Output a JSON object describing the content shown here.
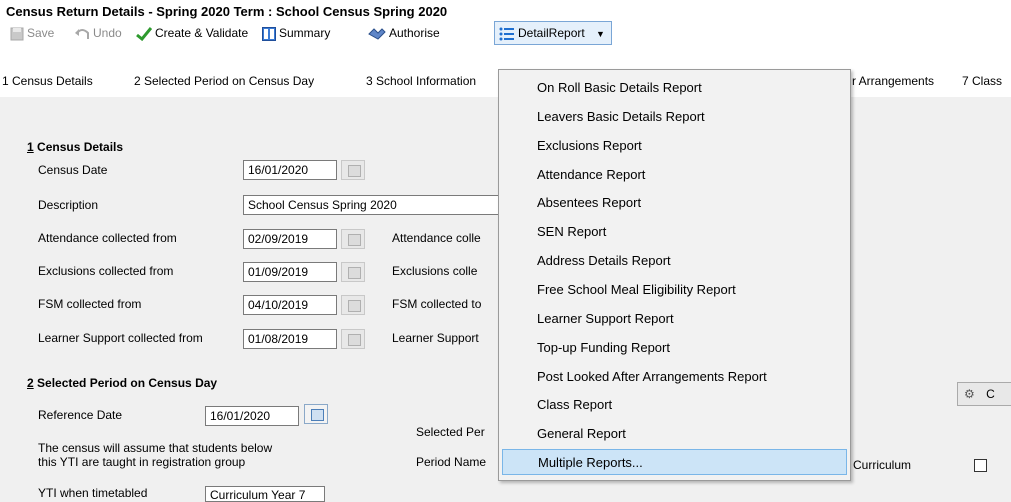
{
  "window": {
    "title": "Census Return Details - Spring 2020 Term : School Census Spring 2020"
  },
  "toolbar": {
    "save": "Save",
    "undo": "Undo",
    "create_validate": "Create & Validate",
    "summary": "Summary",
    "authorise": "Authorise",
    "detail_report": "DetailReport"
  },
  "tabs": [
    "1 Census Details",
    "2 Selected Period on Census Day",
    "3 School Information",
    "r Arrangements",
    "7 Class"
  ],
  "section1": {
    "title_num": "1",
    "title_text": " Census Details",
    "census_date_label": "Census Date",
    "census_date": "16/01/2020",
    "description_label": "Description",
    "description": "School Census Spring 2020",
    "attendance_label": "Attendance collected from",
    "attendance_from": "02/09/2019",
    "attendance_to_label": "Attendance colle",
    "exclusions_label": "Exclusions collected from",
    "exclusions_from": "01/09/2019",
    "exclusions_to_label": "Exclusions colle",
    "fsm_label": "FSM collected from",
    "fsm_from": "04/10/2019",
    "fsm_to_label": "FSM collected to",
    "learner_label": "Learner Support collected from",
    "learner_from": "01/08/2019",
    "learner_to_label": "Learner Support"
  },
  "section2": {
    "title_num": "2",
    "title_text": " Selected Period on Census Day",
    "reference_date_label": "Reference Date",
    "reference_date": "16/01/2020",
    "selected_period_label": "Selected Per",
    "note_line1": "The census will assume that students below",
    "note_line2": "this YTI are taught in registration group",
    "period_name_label": "Period Name",
    "curriculum_label": "Curriculum",
    "yti_label": "YTI when timetabled",
    "yti_value": "Curriculum Year 7",
    "right_btn": "C"
  },
  "detail_menu": {
    "items": [
      "On Roll Basic Details Report",
      "Leavers Basic Details Report",
      "Exclusions Report",
      "Attendance Report",
      "Absentees Report",
      "SEN Report",
      "Address Details Report",
      "Free School Meal Eligibility Report",
      "Learner Support Report",
      "Top-up Funding Report",
      "Post Looked After Arrangements Report",
      "Class Report",
      "General Report",
      "Multiple Reports..."
    ],
    "highlighted_index": 13
  },
  "colors": {
    "menu_highlight": "#cce4f7",
    "panel_bg": "#f0f0f0"
  },
  "icons": [
    "save-icon",
    "undo-icon",
    "create-validate-check-icon",
    "summary-icon",
    "authorise-icon",
    "detail-report-list-icon",
    "dropdown-arrow-icon",
    "calendar-icon",
    "gear-icon"
  ]
}
